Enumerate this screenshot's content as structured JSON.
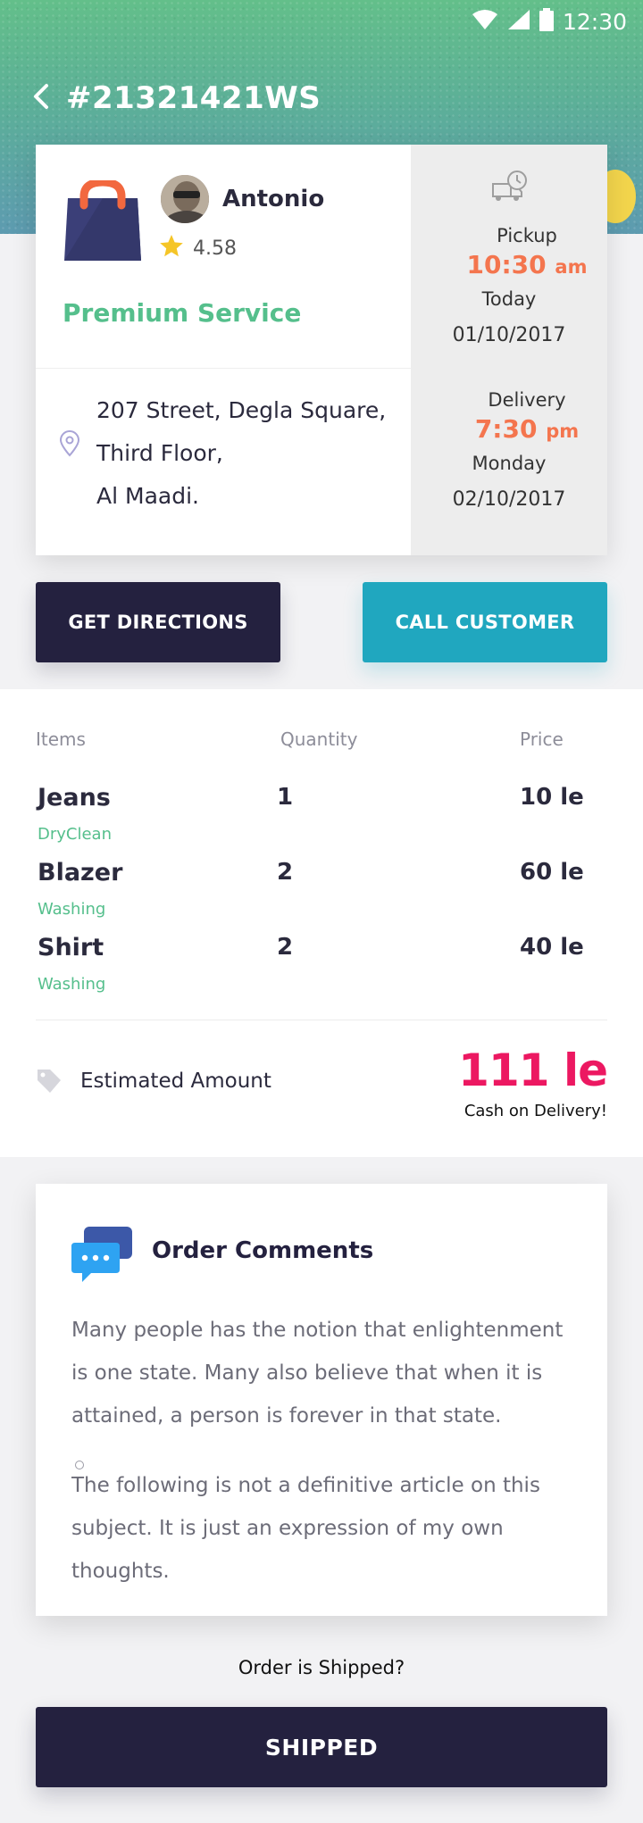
{
  "status_bar": {
    "time": "12:30"
  },
  "header": {
    "order_id": "#21321421WS"
  },
  "order": {
    "customer_name": "Antonio",
    "rating": "4.58",
    "service": "Premium Service",
    "address_lines": [
      "207 Street, Degla Square,",
      "Third Floor,",
      "Al Maadi."
    ],
    "pickup": {
      "label": "Pickup",
      "time": "10:30",
      "ampm": "am",
      "day": "Today",
      "date": "01/10/2017"
    },
    "delivery": {
      "label": "Delivery",
      "time": "7:30",
      "ampm": "pm",
      "day": "Monday",
      "date": "02/10/2017"
    }
  },
  "actions": {
    "directions_label": "GET DIRECTIONS",
    "call_label": "CALL CUSTOMER"
  },
  "items_table": {
    "headers": {
      "items": "Items",
      "quantity": "Quantity",
      "price": "Price"
    },
    "rows": [
      {
        "name": "Jeans",
        "service": "DryClean",
        "qty": "1",
        "price": "10 le"
      },
      {
        "name": "Blazer",
        "service": "Washing",
        "qty": "2",
        "price": "60 le"
      },
      {
        "name": "Shirt",
        "service": "Washing",
        "qty": "2",
        "price": "40 le"
      }
    ]
  },
  "estimate": {
    "label": "Estimated Amount",
    "amount": "111 le",
    "payment": "Cash on Delivery!"
  },
  "comments": {
    "title": "Order Comments",
    "paragraph_1": "Many people has the notion that enlightenment is one state. Many also believe that when it is attained, a person is forever in that state.",
    "paragraph_2": "The following is not a definitive article on this subject. It is just an expression of my own thoughts."
  },
  "footer": {
    "question": "Order is Shipped?",
    "shipped_label": "SHIPPED"
  },
  "colors": {
    "navy": "#24213f",
    "teal": "#20a7bf",
    "green": "#55bf8c",
    "orange": "#f4754e",
    "pink": "#ec1861",
    "chat_blue": "#2ea3f2"
  }
}
